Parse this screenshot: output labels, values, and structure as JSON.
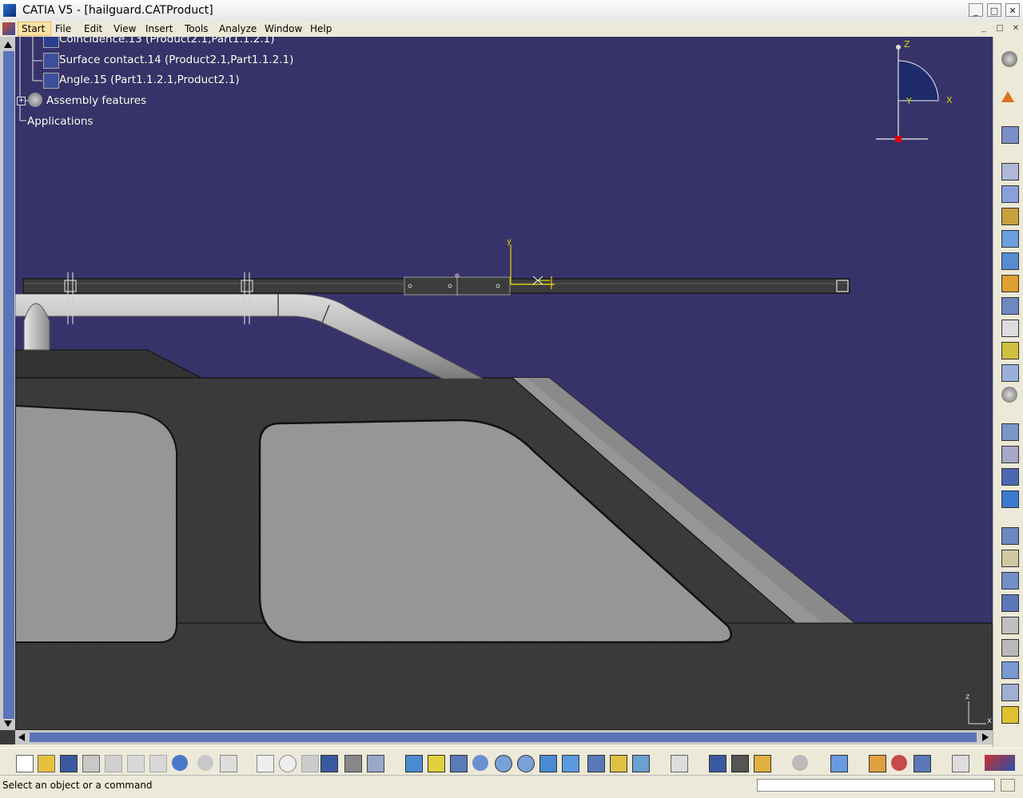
{
  "window": {
    "title": "CATIA V5 - [hailguard.CATProduct]",
    "controls": {
      "minimize": "_",
      "maximize": "□",
      "close": "✕"
    }
  },
  "menubar": {
    "items": [
      "Start",
      "File",
      "Edit",
      "View",
      "Insert",
      "Tools",
      "Analyze",
      "Window",
      "Help"
    ]
  },
  "tree": {
    "items": [
      {
        "label": "Coincidence.13 (Product2.1,Part1.1.2.1)",
        "icon": "coincidence-constraint-icon"
      },
      {
        "label": "Surface contact.14 (Product2.1,Part1.1.2.1)",
        "icon": "surface-contact-constraint-icon"
      },
      {
        "label": "Angle.15 (Part1.1.2.1,Product2.1)",
        "icon": "angle-constraint-icon"
      },
      {
        "label": "Assembly features",
        "icon": "assembly-features-icon"
      },
      {
        "label": "Applications",
        "icon": ""
      }
    ]
  },
  "compass": {
    "axis_x": "X",
    "axis_y": "Y",
    "axis_z": "Z"
  },
  "triad": {
    "axis_x": "x",
    "axis_z": "z"
  },
  "part_axis": {
    "axis_y": "y"
  },
  "status": {
    "message": "Select an object or a command",
    "command_placeholder": ""
  },
  "colors": {
    "viewport_background": "#37336a",
    "scrollbar_track": "#5b73b8",
    "part_gray": "#3a3a3a"
  }
}
